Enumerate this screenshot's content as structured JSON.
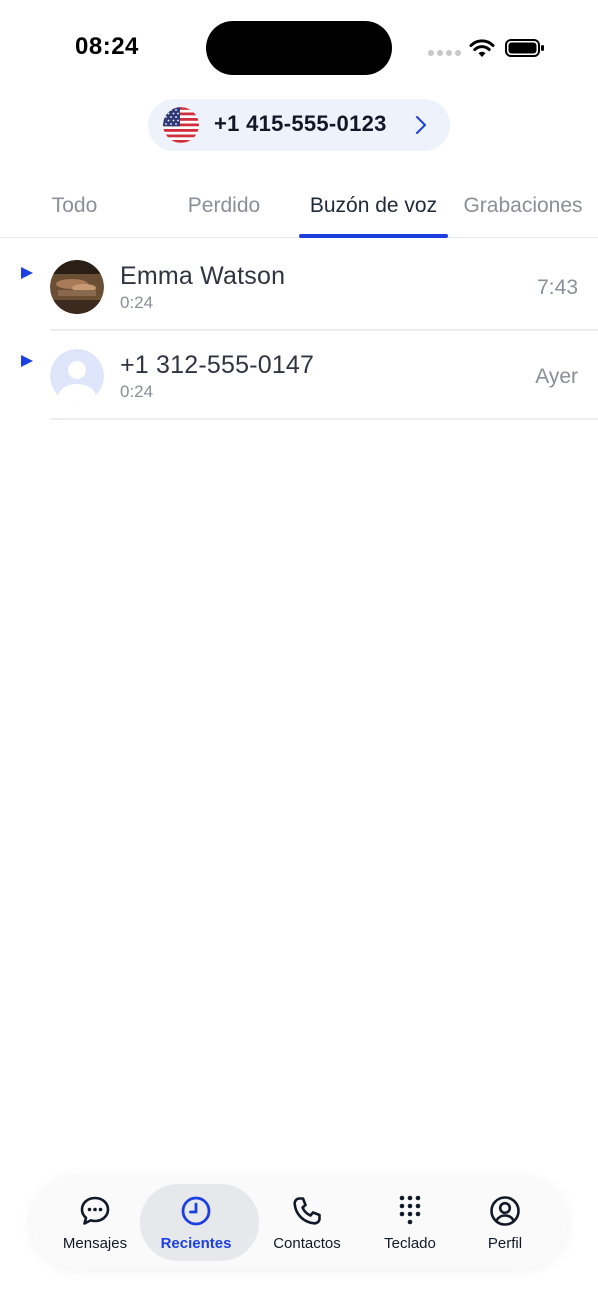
{
  "status_bar": {
    "time": "08:24"
  },
  "header": {
    "phone_number": "+1 415-555-0123"
  },
  "tabs": [
    {
      "label": "Todo"
    },
    {
      "label": "Perdido"
    },
    {
      "label": "Buzón de voz"
    },
    {
      "label": "Grabaciones"
    }
  ],
  "active_tab": "Buzón de voz",
  "voicemails": [
    {
      "name": "Emma Watson",
      "duration": "0:24",
      "time": "7:43"
    },
    {
      "name": "+1 312-555-0147",
      "duration": "0:24",
      "time": "Ayer"
    }
  ],
  "nav": [
    {
      "label": "Mensajes",
      "icon": "chat-bubble-icon"
    },
    {
      "label": "Recientes",
      "icon": "clock-icon"
    },
    {
      "label": "Contactos",
      "icon": "phone-icon"
    },
    {
      "label": "Teclado",
      "icon": "keypad-icon"
    },
    {
      "label": "Perfil",
      "icon": "profile-icon"
    }
  ],
  "active_nav": "Recientes",
  "colors": {
    "accent": "#1d3fe0",
    "pill_bg": "#eef2fa",
    "muted_text": "#8a8f98"
  }
}
